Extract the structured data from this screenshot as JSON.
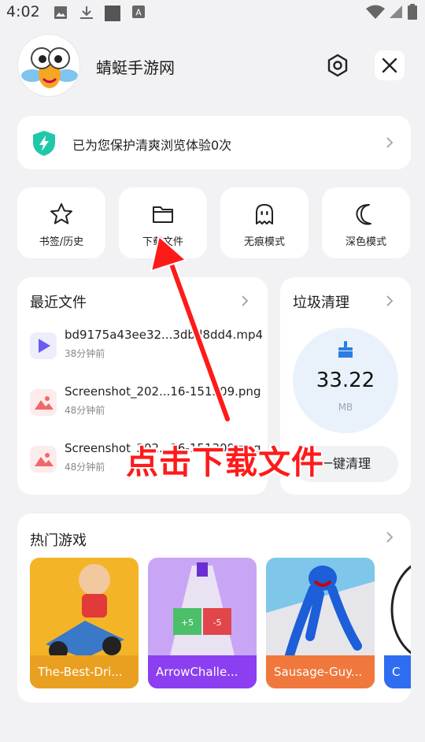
{
  "status_bar": {
    "time": "4:02",
    "icons": [
      "image-icon",
      "download-icon",
      "square-icon",
      "a-box-icon"
    ],
    "right_icons": [
      "wifi-icon",
      "signal-icon",
      "battery-icon"
    ]
  },
  "header": {
    "app_name": "蜻蜓手游网",
    "avatar_icon": "dragonfly-mascot-icon",
    "settings_icon": "settings-hexagon-icon",
    "close_icon": "close-icon"
  },
  "protect_banner": {
    "text": "已为您保护清爽浏览体验0次",
    "icon": "shield-bolt-icon"
  },
  "quick_actions": [
    {
      "label": "书签/历史",
      "icon": "star-icon"
    },
    {
      "label": "下载文件",
      "icon": "folder-icon"
    },
    {
      "label": "无痕模式",
      "icon": "ghost-icon"
    },
    {
      "label": "深色模式",
      "icon": "moon-icon"
    }
  ],
  "recent_files": {
    "title": "最近文件",
    "items": [
      {
        "name": "bd9175a43ee32...3dbd8dd4.mp4",
        "time": "38分钟前",
        "type": "video"
      },
      {
        "name": "Screenshot_202...16-151309.png",
        "time": "48分钟前",
        "type": "image"
      },
      {
        "name": "Screenshot_202...16-151309.png",
        "time": "48分钟前",
        "type": "image"
      }
    ]
  },
  "trash_clean": {
    "title": "垃圾清理",
    "size": "33.22",
    "unit": "MB",
    "button_label": "一键清理",
    "icon": "broom-icon"
  },
  "hot_games": {
    "title": "热门游戏",
    "items": [
      {
        "name": "The-Best-Dri...",
        "label_color": "#e9a020"
      },
      {
        "name": "ArrowChalle...",
        "label_color": "#8b3ff0"
      },
      {
        "name": "Sausage-Guy...",
        "label_color": "#f0783c"
      },
      {
        "name": "C",
        "label_color": "#2f6df0"
      }
    ]
  },
  "annotation": {
    "text": "点击下载文件",
    "color": "#ff1a1a"
  }
}
